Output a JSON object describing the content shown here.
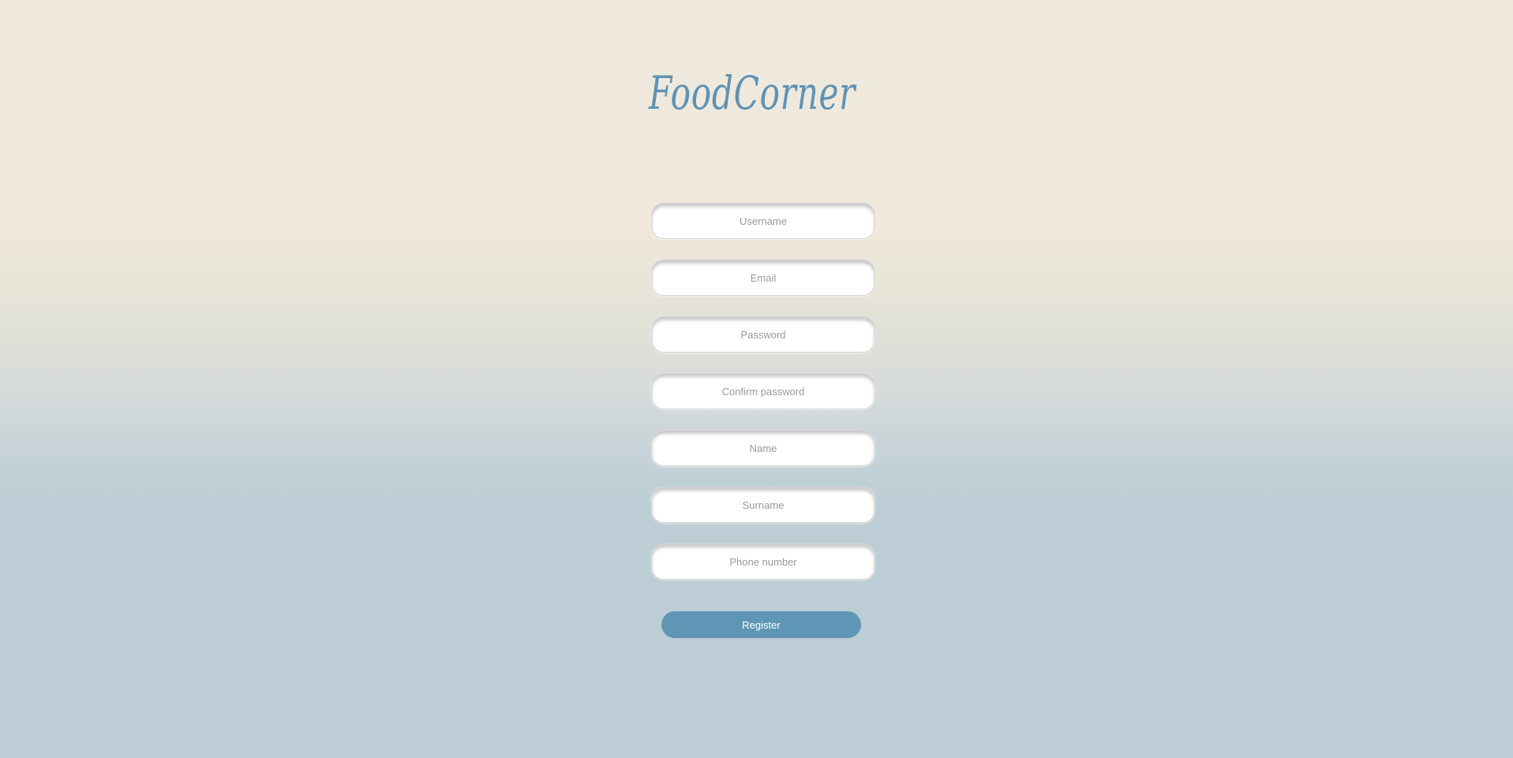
{
  "brand": {
    "logo_text": "FoodCorner"
  },
  "form": {
    "fields": [
      {
        "placeholder": "Username",
        "value": ""
      },
      {
        "placeholder": "Email",
        "value": ""
      },
      {
        "placeholder": "Password",
        "value": ""
      },
      {
        "placeholder": "Confirm password",
        "value": ""
      },
      {
        "placeholder": "Name",
        "value": ""
      },
      {
        "placeholder": "Surname",
        "value": ""
      },
      {
        "placeholder": "Phone number",
        "value": ""
      }
    ],
    "submit_label": "Register"
  },
  "colors": {
    "accent": "#6096b5",
    "logo": "#5d93b5",
    "background_top": "#efe9dd",
    "background_bottom": "#bccdd5"
  }
}
